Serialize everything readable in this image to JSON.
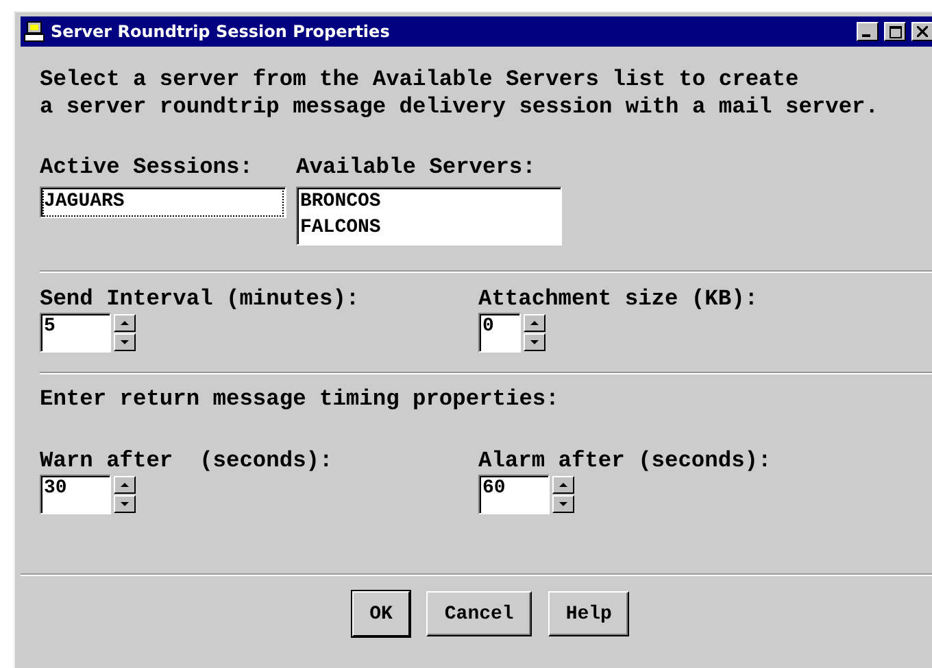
{
  "window": {
    "title": "Server Roundtrip Session Properties"
  },
  "intro": [
    "Select a server from the Available Servers list to create",
    "a server roundtrip message delivery session with a mail server."
  ],
  "active_sessions": {
    "label": "Active Sessions:",
    "items": [
      "JAGUARS"
    ]
  },
  "available_servers": {
    "label": "Available Servers:",
    "items": [
      "BRONCOS",
      "FALCONS"
    ]
  },
  "interval_fields": [
    {
      "label": "Send Interval (minutes):",
      "value": "5"
    },
    {
      "label": "Attachment size (KB):",
      "value": "0"
    }
  ],
  "timing_heading": "Enter return message timing properties:",
  "timing_fields": [
    {
      "label": "Warn after  (seconds):",
      "value": "30"
    },
    {
      "label": "Alarm after (seconds):",
      "value": "60"
    }
  ],
  "buttons": [
    {
      "label": "OK",
      "default": true
    },
    {
      "label": "Cancel",
      "default": false
    },
    {
      "label": "Help",
      "default": false
    }
  ]
}
